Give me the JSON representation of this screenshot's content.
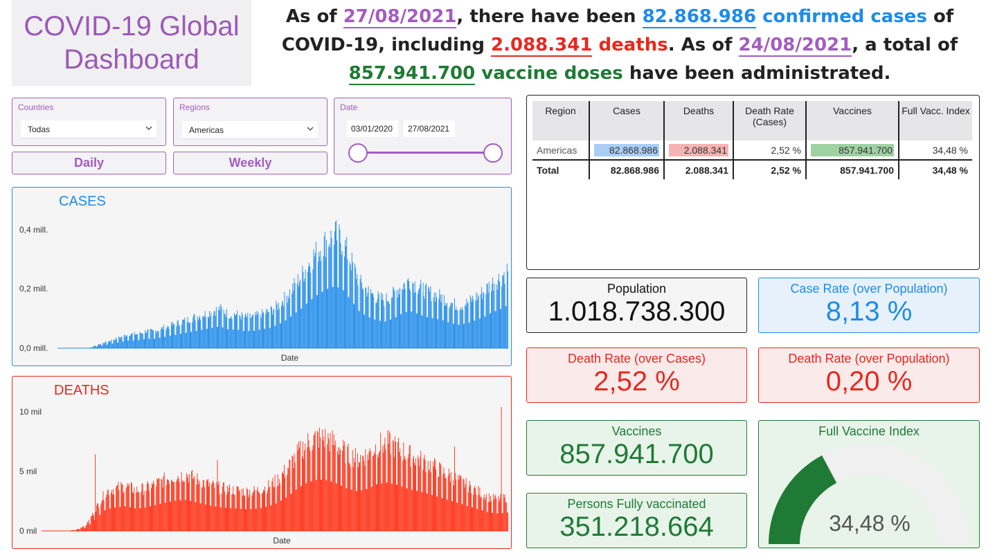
{
  "title": {
    "line1": "COVID-19 Global",
    "line2": "Dashboard"
  },
  "headline": {
    "p1": "As of ",
    "date1": "27/08/2021",
    "p2": ", there have been ",
    "cases": "82.868.986",
    "cases_label": "confirmed cases",
    "p3": " of COVID-19, including ",
    "deaths": "2.088.341",
    "deaths_label": "deaths",
    "p4": ". As of ",
    "date2": "24/08/2021",
    "p5": ", a total of ",
    "vaccines": "857.941.700",
    "vaccines_label": "vaccine doses",
    "p6": " have been administrated."
  },
  "filters": {
    "countries": {
      "label": "Countries",
      "value": "Todas"
    },
    "regions": {
      "label": "Regions",
      "value": "Americas"
    },
    "date": {
      "label": "Date",
      "start": "03/01/2020",
      "end": "27/08/2021",
      "range_start_fraction": 0,
      "range_end_fraction": 1
    }
  },
  "buttons": {
    "daily": "Daily",
    "weekly": "Weekly"
  },
  "chart_data": [
    {
      "type": "bar",
      "title": "CASES",
      "xlabel": "Date",
      "ylabel": "",
      "yticks": [
        "0,0 mill.",
        "0,2 mill.",
        "0,4 mill."
      ],
      "ylim": [
        0,
        0.44
      ],
      "color": "#1e8bea",
      "x_range": [
        "03/01/2020",
        "27/08/2021"
      ],
      "values_mill_approx": [
        0.0,
        0.0,
        0.0,
        0.01,
        0.02,
        0.03,
        0.04,
        0.05,
        0.05,
        0.06,
        0.06,
        0.07,
        0.08,
        0.09,
        0.1,
        0.11,
        0.12,
        0.13,
        0.14,
        0.12,
        0.12,
        0.11,
        0.11,
        0.12,
        0.13,
        0.15,
        0.18,
        0.22,
        0.26,
        0.31,
        0.35,
        0.38,
        0.4,
        0.37,
        0.3,
        0.23,
        0.2,
        0.18,
        0.17,
        0.19,
        0.22,
        0.24,
        0.22,
        0.2,
        0.19,
        0.18,
        0.16,
        0.15,
        0.16,
        0.18,
        0.2,
        0.23,
        0.25,
        0.28
      ]
    },
    {
      "type": "bar",
      "title": "DEATHS",
      "xlabel": "Date",
      "ylabel": "",
      "yticks": [
        "0 mil",
        "5 mil",
        "10 mil"
      ],
      "ylim": [
        0,
        10.5
      ],
      "color": "#ff2a0d",
      "x_range": [
        "03/01/2020",
        "27/08/2021"
      ],
      "values_thousand_approx": [
        0.0,
        0.0,
        0.1,
        0.5,
        2.0,
        3.5,
        3.8,
        4.0,
        3.6,
        3.8,
        4.2,
        4.6,
        4.9,
        5.0,
        4.6,
        4.2,
        3.9,
        3.7,
        3.6,
        3.5,
        3.6,
        3.9,
        4.5,
        5.5,
        6.8,
        7.8,
        8.3,
        8.2,
        7.6,
        6.8,
        6.4,
        6.8,
        7.6,
        7.8,
        7.4,
        6.8,
        6.4,
        6.0,
        5.5,
        5.0,
        4.5,
        4.0,
        3.5,
        3.0,
        2.8,
        3.0
      ]
    }
  ],
  "table": {
    "headers": [
      "Region",
      "Cases",
      "Deaths",
      "Death Rate (Cases)",
      "Vaccines",
      "Full Vacc. Index"
    ],
    "rows": [
      [
        "Americas",
        "82.868.986",
        "2.088.341",
        "2,52 %",
        "857.941.700",
        "34,48 %"
      ]
    ],
    "total": [
      "Total",
      "82.868.986",
      "2.088.341",
      "2,52 %",
      "857.941.700",
      "34,48 %"
    ]
  },
  "kpis": {
    "population": {
      "title": "Population",
      "value": "1.018.738.300"
    },
    "case_rate": {
      "title": "Case Rate (over Population)",
      "value": "8,13 %"
    },
    "death_rate_cases": {
      "title": "Death Rate (over Cases)",
      "value": "2,52 %"
    },
    "death_rate_pop": {
      "title": "Death Rate (over Population)",
      "value": "0,20 %"
    },
    "vaccines": {
      "title": "Vaccines",
      "value": "857.941.700"
    },
    "fully_vaccinated": {
      "title": "Persons Fully vaccinated",
      "value": "351.218.664"
    },
    "full_vaccine_index": {
      "title": "Full Vaccine Index",
      "value": "34,48 %",
      "fraction": 0.3448
    }
  },
  "colors": {
    "purple": "#a35cc0",
    "blue": "#1e8bea",
    "red": "#e8281e",
    "green": "#1f7a35"
  }
}
